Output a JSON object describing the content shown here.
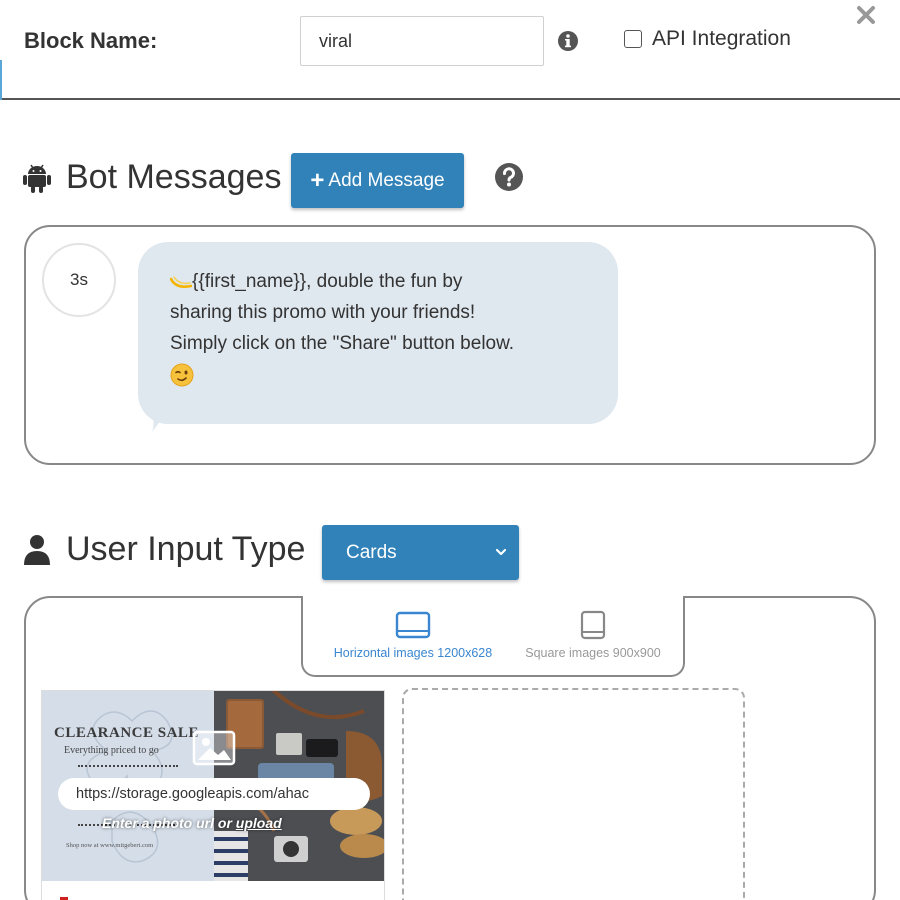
{
  "header": {
    "block_name_label": "Block Name:",
    "block_name_value": "viral",
    "api_label": "API Integration",
    "api_checked": false
  },
  "bot_messages": {
    "title": "Bot Messages",
    "add_button_label": "Add Message",
    "add_button_icon": "plus-icon",
    "title_icon": "android-icon",
    "help_icon": "question-circle-icon",
    "messages": [
      {
        "delay": "3s",
        "lines": [
          "{{first_name}}, double the fun by",
          "sharing this promo with your friends!",
          "Simply click on the \"Share\" button below."
        ]
      }
    ]
  },
  "user_input": {
    "title": "User Input Type",
    "title_icon": "user-icon",
    "selected_type": "Cards",
    "image_options": [
      {
        "label": "Horizontal images 1200x628",
        "active": true
      },
      {
        "label": "Square images 900x900",
        "active": false
      }
    ],
    "card": {
      "image_title": "CLEARANCE SALE",
      "image_subtitle": "Everything priced to go",
      "image_footer": "Shop now at www.mitgebert.com",
      "url_value": "https://storage.googleapis.com/ahac",
      "hint_prefix": "Enter a photo url or ",
      "hint_link": "upload"
    }
  },
  "colors": {
    "accent_blue": "#3182b9",
    "bubble_bg": "#dfe7ef",
    "active_option": "#3a86d0"
  }
}
